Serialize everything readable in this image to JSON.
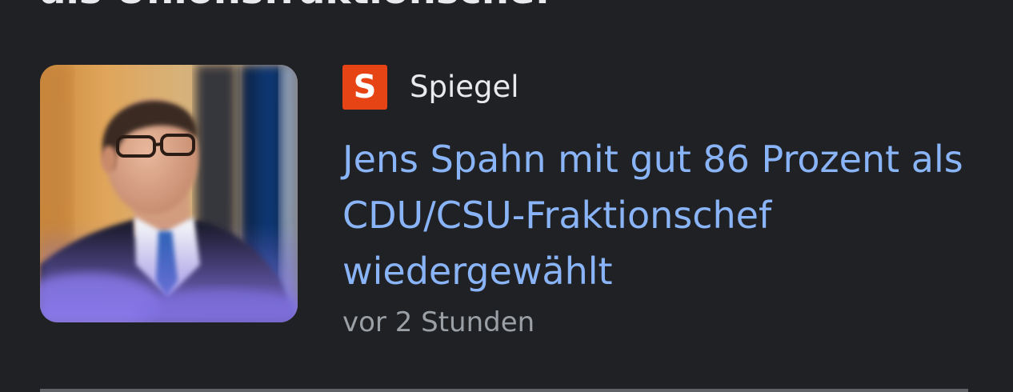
{
  "previous_item": {
    "headline_fragment": "als Unionsfraktionschef"
  },
  "article": {
    "source": {
      "name": "Spiegel",
      "logo_letter": "S",
      "logo_color": "#e64415"
    },
    "headline": "Jens Spahn mit gut 86 Prozent als CDU/CSU-Fraktionschef wiedergewählt",
    "timestamp": "vor 2 Stunden"
  },
  "colors": {
    "background": "#202124",
    "headline_link": "#8ab4f8",
    "source_text": "#e8eaed",
    "timestamp_text": "#9aa0a6",
    "divider": "#5f6368"
  }
}
